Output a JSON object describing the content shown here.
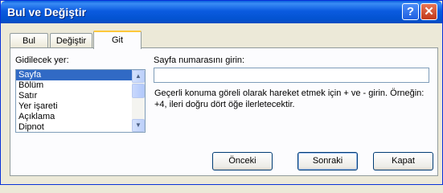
{
  "window": {
    "title": "Bul ve Değiştir",
    "help_glyph": "?",
    "close_glyph": "✕"
  },
  "tabs": [
    {
      "label": "Bul",
      "active": false
    },
    {
      "label": "Değiştir",
      "active": false
    },
    {
      "label": "Git",
      "active": true
    }
  ],
  "goto": {
    "list_label": "Gidilecek yer:",
    "items": [
      "Sayfa",
      "Bölüm",
      "Satır",
      "Yer işareti",
      "Açıklama",
      "Dipnot"
    ],
    "selected": "Sayfa",
    "input_label": "Sayfa numarasını girin:",
    "input_value": "",
    "hint": "Geçerli konuma göreli olarak hareket etmek için + ve - girin. Örneğin: +4, ileri doğru dört öğe ilerletecektir."
  },
  "buttons": {
    "previous": "Önceki",
    "next": "Sonraki",
    "close": "Kapat"
  }
}
